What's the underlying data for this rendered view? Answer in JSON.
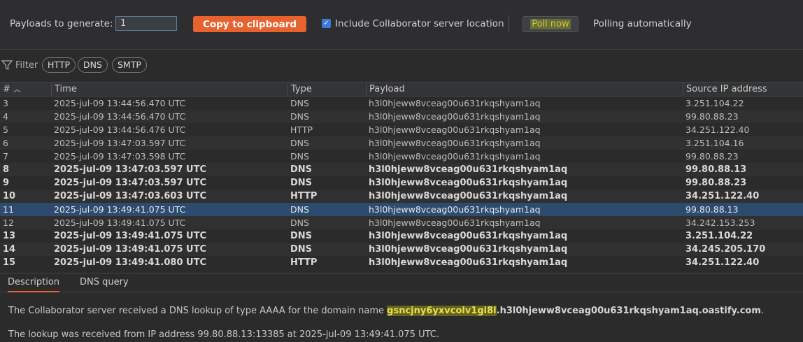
{
  "toolbar": {
    "payloads_label": "Payloads to generate:",
    "payloads_value": "1",
    "copy_button": "Copy to clipboard",
    "include_label": "Include Collaborator server location",
    "include_checked": true,
    "poll_now": "Poll now",
    "polling_status": "Polling automatically",
    "accent_color": "#e8622d"
  },
  "filter": {
    "label": "Filter",
    "icon": "funnel-icon",
    "chips": [
      "HTTP",
      "DNS",
      "SMTP"
    ]
  },
  "table": {
    "columns": [
      "#",
      "Time",
      "Type",
      "Payload",
      "Source IP address"
    ],
    "sort_indicator": "^",
    "rows": [
      {
        "num": "3",
        "time": "2025-jul-09 13:44:56.470 UTC",
        "type": "DNS",
        "payload": "h3l0hjeww8vceag00u631rkqshyam1aq",
        "ip": "3.251.104.22",
        "bold": false
      },
      {
        "num": "4",
        "time": "2025-jul-09 13:44:56.470 UTC",
        "type": "DNS",
        "payload": "h3l0hjeww8vceag00u631rkqshyam1aq",
        "ip": "99.80.88.23",
        "bold": false
      },
      {
        "num": "5",
        "time": "2025-jul-09 13:44:56.476 UTC",
        "type": "HTTP",
        "payload": "h3l0hjeww8vceag00u631rkqshyam1aq",
        "ip": "34.251.122.40",
        "bold": false
      },
      {
        "num": "6",
        "time": "2025-jul-09 13:47:03.597 UTC",
        "type": "DNS",
        "payload": "h3l0hjeww8vceag00u631rkqshyam1aq",
        "ip": "3.251.104.16",
        "bold": false
      },
      {
        "num": "7",
        "time": "2025-jul-09 13:47:03.598 UTC",
        "type": "DNS",
        "payload": "h3l0hjeww8vceag00u631rkqshyam1aq",
        "ip": "99.80.88.23",
        "bold": false
      },
      {
        "num": "8",
        "time": "2025-jul-09 13:47:03.597 UTC",
        "type": "DNS",
        "payload": "h3l0hjeww8vceag00u631rkqshyam1aq",
        "ip": "99.80.88.13",
        "bold": true
      },
      {
        "num": "9",
        "time": "2025-jul-09 13:47:03.597 UTC",
        "type": "DNS",
        "payload": "h3l0hjeww8vceag00u631rkqshyam1aq",
        "ip": "99.80.88.23",
        "bold": true
      },
      {
        "num": "10",
        "time": "2025-jul-09 13:47:03.603 UTC",
        "type": "HTTP",
        "payload": "h3l0hjeww8vceag00u631rkqshyam1aq",
        "ip": "34.251.122.40",
        "bold": true
      },
      {
        "num": "11",
        "time": "2025-jul-09 13:49:41.075 UTC",
        "type": "DNS",
        "payload": "h3l0hjeww8vceag00u631rkqshyam1aq",
        "ip": "99.80.88.13",
        "bold": false,
        "selected": true
      },
      {
        "num": "12",
        "time": "2025-jul-09 13:49:41.075 UTC",
        "type": "DNS",
        "payload": "h3l0hjeww8vceag00u631rkqshyam1aq",
        "ip": "34.242.153.253",
        "bold": false
      },
      {
        "num": "13",
        "time": "2025-jul-09 13:49:41.075 UTC",
        "type": "DNS",
        "payload": "h3l0hjeww8vceag00u631rkqshyam1aq",
        "ip": "3.251.104.22",
        "bold": true
      },
      {
        "num": "14",
        "time": "2025-jul-09 13:49:41.075 UTC",
        "type": "DNS",
        "payload": "h3l0hjeww8vceag00u631rkqshyam1aq",
        "ip": "34.245.205.170",
        "bold": true
      },
      {
        "num": "15",
        "time": "2025-jul-09 13:49:41.080 UTC",
        "type": "HTTP",
        "payload": "h3l0hjeww8vceag00u631rkqshyam1aq",
        "ip": "34.251.122.40",
        "bold": true
      }
    ]
  },
  "details": {
    "tabs": [
      "Description",
      "DNS query"
    ],
    "active_tab": "Description",
    "desc_prefix": "The Collaborator server received a DNS lookup of type AAAA for the domain name ",
    "desc_highlight": "gsncjny6yxvcolv1gi8l",
    "desc_domain": ".h3l0hjeww8vceag00u631rkqshyam1aq.oastify.com",
    "desc_suffix": ".",
    "desc_line2": "The lookup was received from IP address 99.80.88.13:13385 at 2025-jul-09 13:49:41.075 UTC."
  }
}
